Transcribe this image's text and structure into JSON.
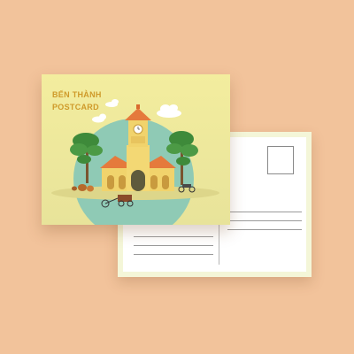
{
  "postcard": {
    "title_line1": "BẾN THÀNH",
    "title_line2": "POSTCARD"
  },
  "colors": {
    "background": "#f2c39b",
    "card_front": "#f0eaa0",
    "card_back_border": "#f4f6d8",
    "title_text": "#cf9a2a",
    "sky_disc": "#8fcab5"
  },
  "icons": [
    "clock-tower-icon",
    "tree-icon",
    "cloud-icon",
    "bicycle-cart-icon",
    "motorbike-icon",
    "stamp-box-icon"
  ]
}
